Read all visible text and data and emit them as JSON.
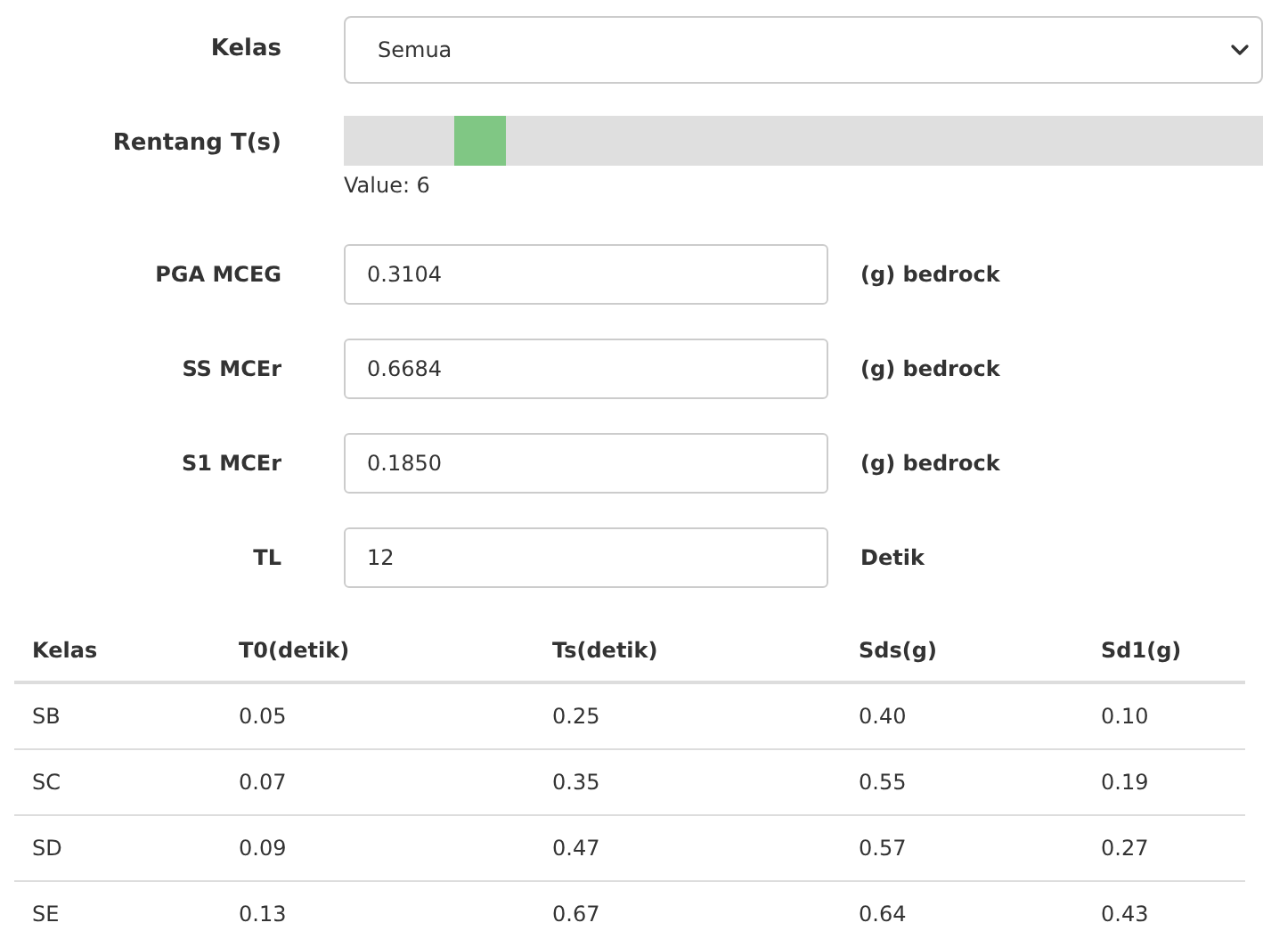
{
  "class_select": {
    "label": "Kelas",
    "value": "Semua"
  },
  "range": {
    "label": "Rentang T(s)",
    "level": 0.12,
    "reading": "Value: 6"
  },
  "fields": [
    {
      "label": "PGA MCEG",
      "value": "0.3104",
      "unit": "(g) bedrock"
    },
    {
      "label": "SS MCEr",
      "value": "0.6684",
      "unit": "(g) bedrock"
    },
    {
      "label": "S1 MCEr",
      "value": "0.1850",
      "unit": "(g) bedrock"
    },
    {
      "label": "TL",
      "value": "12",
      "unit": "Detik"
    }
  ],
  "table": {
    "columns": [
      "Kelas",
      "T0(detik)",
      "Ts(detik)",
      "Sds(g)",
      "Sd1(g)"
    ],
    "rows": [
      [
        "SB",
        "0.05",
        "0.25",
        "0.40",
        "0.10"
      ],
      [
        "SC",
        "0.07",
        "0.35",
        "0.55",
        "0.19"
      ],
      [
        "SD",
        "0.09",
        "0.47",
        "0.57",
        "0.27"
      ],
      [
        "SE",
        "0.13",
        "0.67",
        "0.64",
        "0.43"
      ]
    ]
  }
}
